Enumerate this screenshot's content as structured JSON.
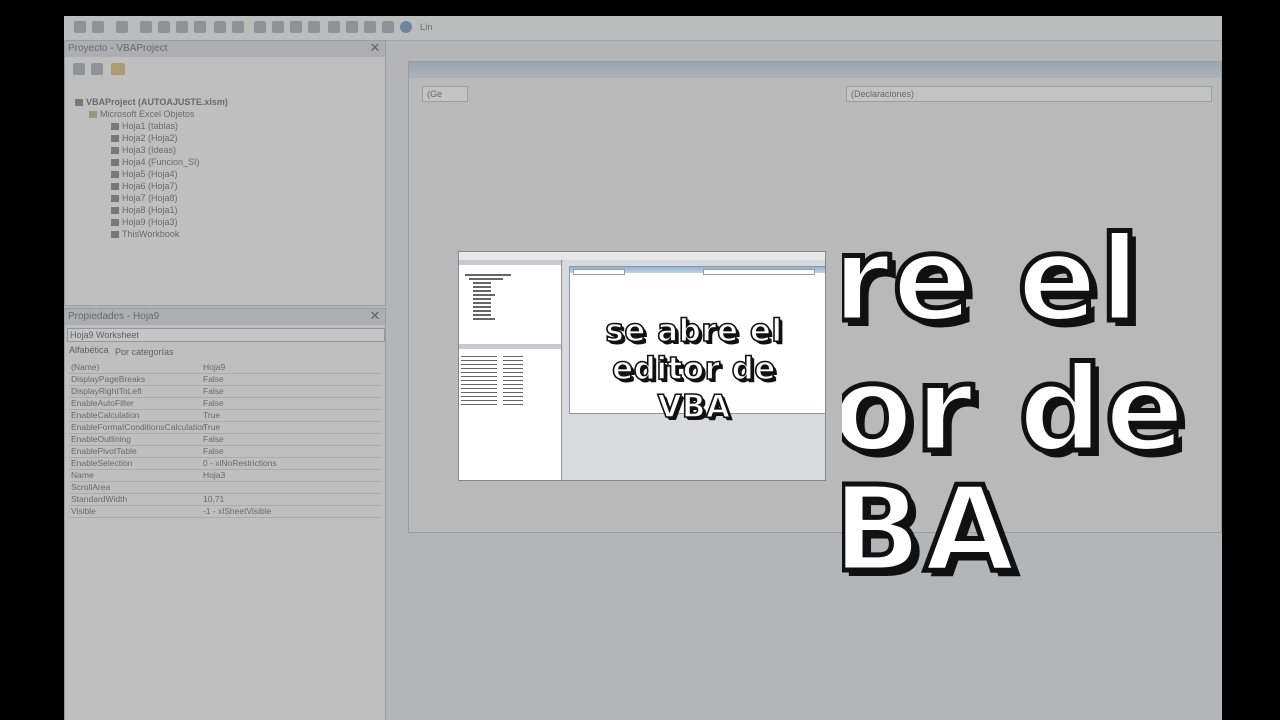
{
  "caption": {
    "line1": "se abre el",
    "line2": "editor de",
    "line3": "VBA"
  },
  "background_caption": {
    "line1": "re el",
    "line2": "or de",
    "line3": "BA"
  },
  "project_pane": {
    "title": "Proyecto - VBAProject",
    "root": "VBAProject (AUTOAJUSTE.xlsm)",
    "folder": "Microsoft Excel Objetos",
    "items": [
      "Hoja1 (tablas)",
      "Hoja2 (Hoja2)",
      "Hoja3 (Ideas)",
      "Hoja4 (Funcion_SI)",
      "Hoja5 (Hoja4)",
      "Hoja6 (Hoja7)",
      "Hoja7 (Hoja8)",
      "Hoja8 (Hoja1)",
      "Hoja9 (Hoja3)",
      "ThisWorkbook"
    ]
  },
  "properties_pane": {
    "title": "Propiedades - Hoja9",
    "object": "Hoja9 Worksheet",
    "tabs": [
      "Alfabética",
      "Por categorías"
    ],
    "rows": [
      {
        "key": "(Name)",
        "value": "Hoja9"
      },
      {
        "key": "DisplayPageBreaks",
        "value": "False"
      },
      {
        "key": "DisplayRightToLeft",
        "value": "False"
      },
      {
        "key": "EnableAutoFilter",
        "value": "False"
      },
      {
        "key": "EnableCalculation",
        "value": "True"
      },
      {
        "key": "EnableFormatConditionsCalculation",
        "value": "True"
      },
      {
        "key": "EnableOutlining",
        "value": "False"
      },
      {
        "key": "EnablePivotTable",
        "value": "False"
      },
      {
        "key": "EnableSelection",
        "value": "0 - xlNoRestrictions"
      },
      {
        "key": "Name",
        "value": "Hoja3"
      },
      {
        "key": "ScrollArea",
        "value": ""
      },
      {
        "key": "StandardWidth",
        "value": "10,71"
      },
      {
        "key": "Visible",
        "value": "-1 - xlSheetVisible"
      }
    ]
  },
  "code_window": {
    "general_dropdown": "(Ge",
    "declarations_dropdown": "(Declaraciones)",
    "toolbar_pos": "Lín"
  },
  "colors": {
    "caption_fill": "#ffffff",
    "caption_stroke": "#111111",
    "background": "#000000"
  }
}
